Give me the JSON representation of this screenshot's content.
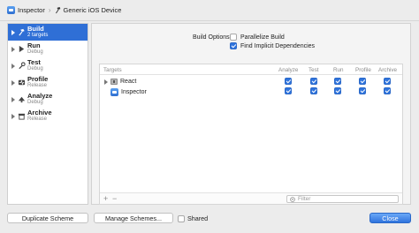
{
  "breadcrumb": {
    "scheme": "Inspector",
    "destination": "Generic iOS Device"
  },
  "sidebar": {
    "items": [
      {
        "label": "Build",
        "sub": "2 targets",
        "icon": "hammer-icon",
        "active": true
      },
      {
        "label": "Run",
        "sub": "Debug",
        "icon": "play-icon"
      },
      {
        "label": "Test",
        "sub": "Debug",
        "icon": "wrench-icon"
      },
      {
        "label": "Profile",
        "sub": "Release",
        "icon": "instruments-icon"
      },
      {
        "label": "Analyze",
        "sub": "Debug",
        "icon": "analyze-icon"
      },
      {
        "label": "Archive",
        "sub": "Release",
        "icon": "archive-icon"
      }
    ]
  },
  "build_options": {
    "label": "Build Options",
    "parallelize": {
      "label": "Parallelize Build",
      "checked": false
    },
    "implicit": {
      "label": "Find Implicit Dependencies",
      "checked": true
    }
  },
  "targets_table": {
    "columns": [
      "Targets",
      "Analyze",
      "Test",
      "Run",
      "Profile",
      "Archive"
    ],
    "rows": [
      {
        "name": "React",
        "icon": "library-icon",
        "checks": [
          true,
          true,
          true,
          true,
          true
        ]
      },
      {
        "name": "Inspector",
        "icon": "app-icon",
        "checks": [
          true,
          true,
          true,
          true,
          true
        ]
      }
    ],
    "add_label": "+",
    "remove_label": "−",
    "filter_placeholder": "Filter"
  },
  "footer": {
    "duplicate": "Duplicate Scheme",
    "manage": "Manage Schemes...",
    "shared": "Shared",
    "close": "Close"
  },
  "colors": {
    "accent": "#2f6fd6",
    "checkbox_on": "#2f74dd"
  }
}
